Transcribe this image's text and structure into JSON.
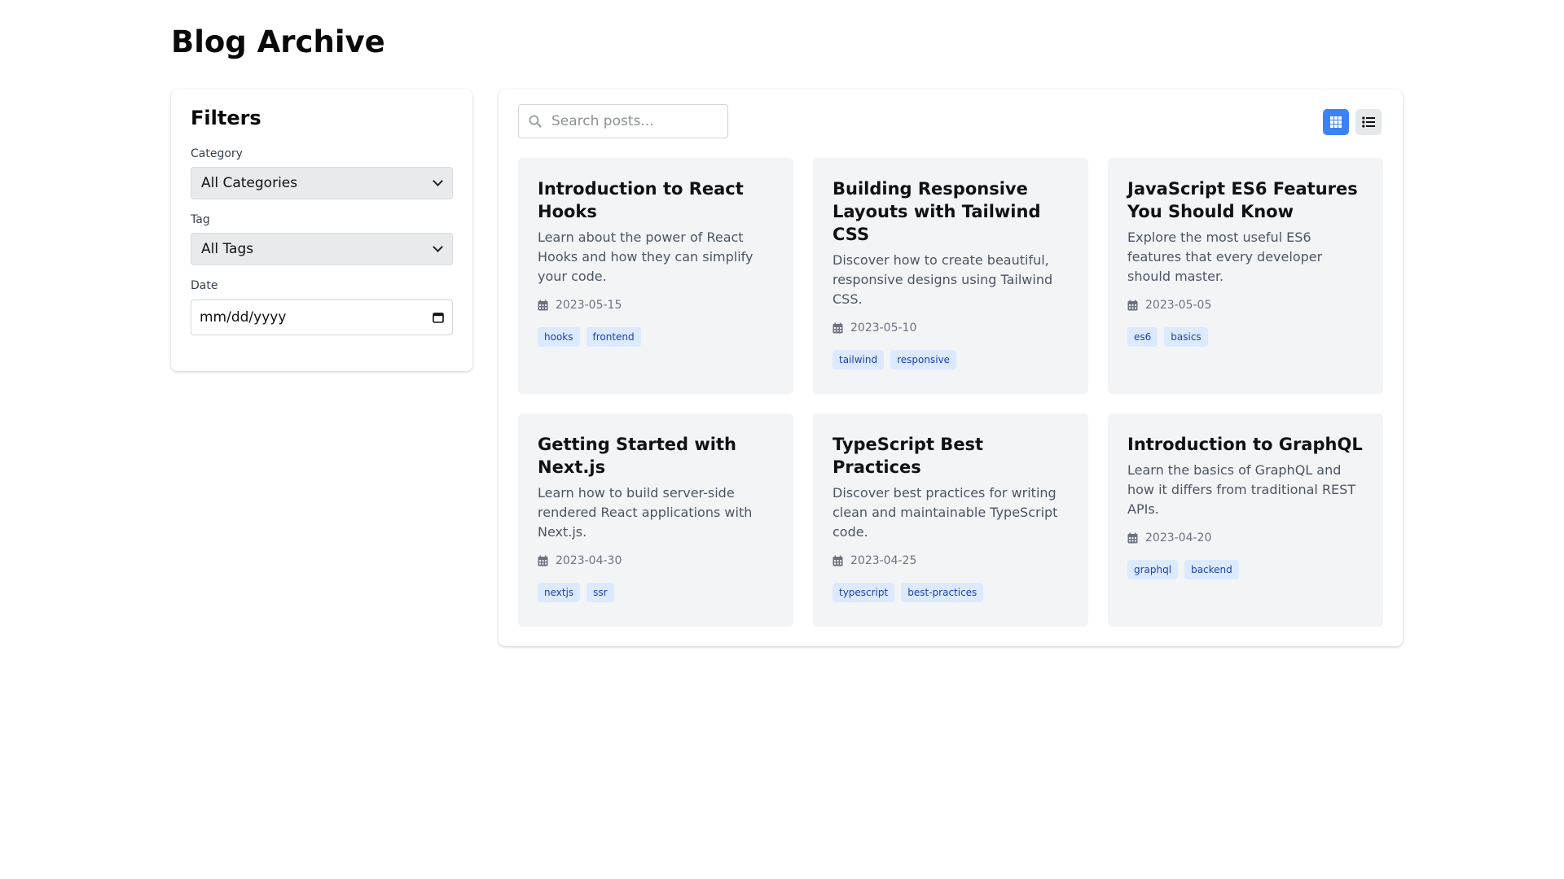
{
  "page": {
    "title": "Blog Archive"
  },
  "filters": {
    "title": "Filters",
    "category_label": "Category",
    "category_value": "All Categories",
    "tag_label": "Tag",
    "tag_value": "All Tags",
    "date_label": "Date",
    "date_placeholder": "mm/dd/yyyy"
  },
  "toolbar": {
    "search_placeholder": "Search posts...",
    "active_view": "grid",
    "accent_color": "#3b82f6"
  },
  "posts": [
    {
      "title": "Introduction to React Hooks",
      "description": "Learn about the power of React Hooks and how they can simplify your code.",
      "date": "2023-05-15",
      "tags": [
        "hooks",
        "frontend"
      ]
    },
    {
      "title": "Building Responsive Layouts with Tailwind CSS",
      "description": "Discover how to create beautiful, responsive designs using Tailwind CSS.",
      "date": "2023-05-10",
      "tags": [
        "tailwind",
        "responsive"
      ]
    },
    {
      "title": "JavaScript ES6 Features You Should Know",
      "description": "Explore the most useful ES6 features that every developer should master.",
      "date": "2023-05-05",
      "tags": [
        "es6",
        "basics"
      ]
    },
    {
      "title": "Getting Started with Next.js",
      "description": "Learn how to build server-side rendered React applications with Next.js.",
      "date": "2023-04-30",
      "tags": [
        "nextjs",
        "ssr"
      ]
    },
    {
      "title": "TypeScript Best Practices",
      "description": "Discover best practices for writing clean and maintainable TypeScript code.",
      "date": "2023-04-25",
      "tags": [
        "typescript",
        "best-practices"
      ]
    },
    {
      "title": "Introduction to GraphQL",
      "description": "Learn the basics of GraphQL and how it differs from traditional REST APIs.",
      "date": "2023-04-20",
      "tags": [
        "graphql",
        "backend"
      ]
    }
  ]
}
